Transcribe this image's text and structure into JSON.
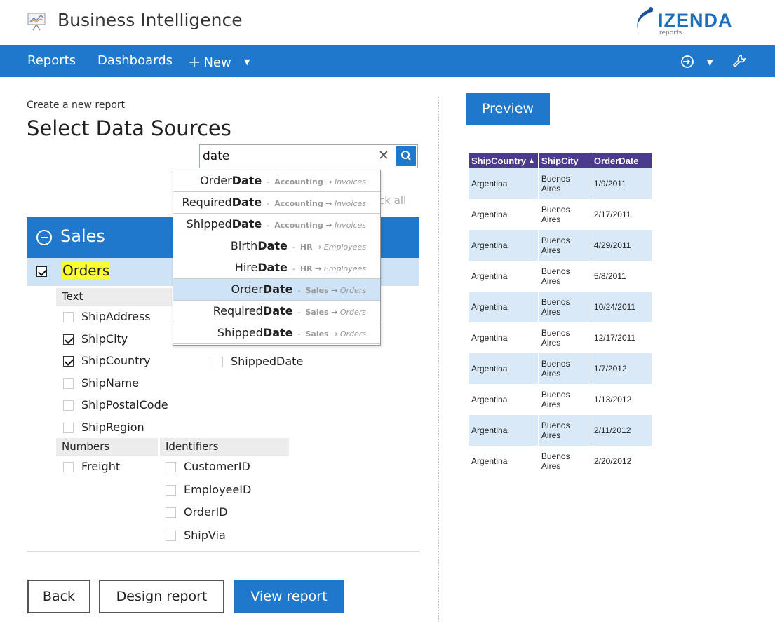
{
  "header": {
    "title": "Business Intelligence",
    "logo_text": "IZENDA",
    "logo_sub": "reports"
  },
  "nav": {
    "reports": "Reports",
    "dashboards": "Dashboards",
    "new": "New"
  },
  "page": {
    "subtitle": "Create a new report",
    "title": "Select Data Sources"
  },
  "search": {
    "value": "date",
    "check_all": "ck all"
  },
  "dropdown": [
    {
      "prefix": "Order",
      "match": "Date",
      "source": "Accounting",
      "table": "Invoices",
      "selected": false
    },
    {
      "prefix": "Required",
      "match": "Date",
      "source": "Accounting",
      "table": "Invoices",
      "selected": false
    },
    {
      "prefix": "Shipped",
      "match": "Date",
      "source": "Accounting",
      "table": "Invoices",
      "selected": false
    },
    {
      "prefix": "Birth",
      "match": "Date",
      "source": "HR",
      "table": "Employees",
      "selected": false
    },
    {
      "prefix": "Hire",
      "match": "Date",
      "source": "HR",
      "table": "Employees",
      "selected": false
    },
    {
      "prefix": "Order",
      "match": "Date",
      "source": "Sales",
      "table": "Orders",
      "selected": true
    },
    {
      "prefix": "Required",
      "match": "Date",
      "source": "Sales",
      "table": "Orders",
      "selected": false
    },
    {
      "prefix": "Shipped",
      "match": "Date",
      "source": "Sales",
      "table": "Orders",
      "selected": false
    }
  ],
  "category": {
    "label": "Sales"
  },
  "table": {
    "label": "Orders",
    "checked": true
  },
  "groups": {
    "text": "Text",
    "numbers": "Numbers",
    "identifiers": "Identifiers"
  },
  "text_fields": [
    {
      "label": "ShipAddress",
      "checked": false
    },
    {
      "label": "ShipCity",
      "checked": true
    },
    {
      "label": "ShipCountry",
      "checked": true
    },
    {
      "label": "ShipName",
      "checked": false
    },
    {
      "label": "ShipPostalCode",
      "checked": false
    },
    {
      "label": "ShipRegion",
      "checked": false
    }
  ],
  "date_fields": [
    {
      "label": "ShippedDate",
      "checked": false
    }
  ],
  "number_fields": [
    {
      "label": "Freight",
      "checked": false
    }
  ],
  "identifier_fields": [
    {
      "label": "CustomerID",
      "checked": false
    },
    {
      "label": "EmployeeID",
      "checked": false
    },
    {
      "label": "OrderID",
      "checked": false
    },
    {
      "label": "ShipVia",
      "checked": false
    }
  ],
  "buttons": {
    "back": "Back",
    "design": "Design report",
    "view": "View report",
    "preview": "Preview"
  },
  "preview_table": {
    "headers": [
      "ShipCountry",
      "ShipCity",
      "OrderDate"
    ],
    "sort_indicator": "▲",
    "rows": [
      [
        "Argentina",
        "Buenos Aires",
        "1/9/2011"
      ],
      [
        "Argentina",
        "Buenos Aires",
        "2/17/2011"
      ],
      [
        "Argentina",
        "Buenos Aires",
        "4/29/2011"
      ],
      [
        "Argentina",
        "Buenos Aires",
        "5/8/2011"
      ],
      [
        "Argentina",
        "Buenos Aires",
        "10/24/2011"
      ],
      [
        "Argentina",
        "Buenos Aires",
        "12/17/2011"
      ],
      [
        "Argentina",
        "Buenos Aires",
        "1/7/2012"
      ],
      [
        "Argentina",
        "Buenos Aires",
        "1/13/2012"
      ],
      [
        "Argentina",
        "Buenos Aires",
        "2/11/2012"
      ],
      [
        "Argentina",
        "Buenos Aires",
        "2/20/2012"
      ]
    ]
  },
  "colors": {
    "accent": "#1f78cc",
    "table_header": "#4a3b8c",
    "row_alt": "#d9e9f7",
    "highlight": "#ffff33"
  }
}
